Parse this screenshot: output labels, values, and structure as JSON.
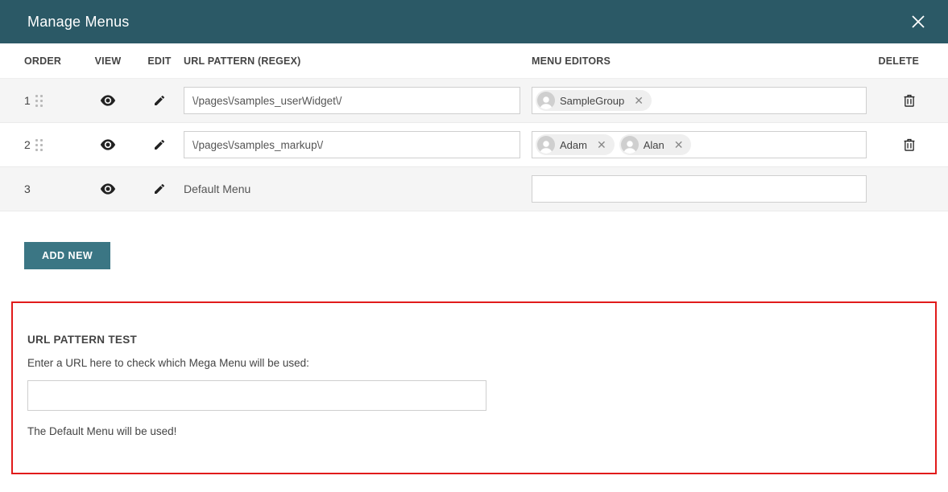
{
  "titlebar": {
    "title": "Manage Menus"
  },
  "columns": {
    "order": "ORDER",
    "view": "VIEW",
    "edit": "EDIT",
    "url": "URL PATTERN (REGEX)",
    "editors": "MENU EDITORS",
    "delete": "DELETE"
  },
  "rows": [
    {
      "order": "1",
      "draggable": true,
      "url_pattern": "\\/pages\\/samples_userWidget\\/",
      "url_static": false,
      "editors": [
        {
          "label": "SampleGroup"
        }
      ],
      "deletable": true
    },
    {
      "order": "2",
      "draggable": true,
      "url_pattern": "\\/pages\\/samples_markup\\/",
      "url_static": false,
      "editors": [
        {
          "label": "Adam"
        },
        {
          "label": "Alan"
        }
      ],
      "deletable": true
    },
    {
      "order": "3",
      "draggable": false,
      "url_pattern": "Default Menu",
      "url_static": true,
      "editors": [],
      "deletable": false
    }
  ],
  "buttons": {
    "add_new": "ADD NEW"
  },
  "test": {
    "heading": "URL PATTERN TEST",
    "instruction": "Enter a URL here to check which Mega Menu will be used:",
    "input_value": "",
    "result": "The Default Menu will be used!"
  }
}
